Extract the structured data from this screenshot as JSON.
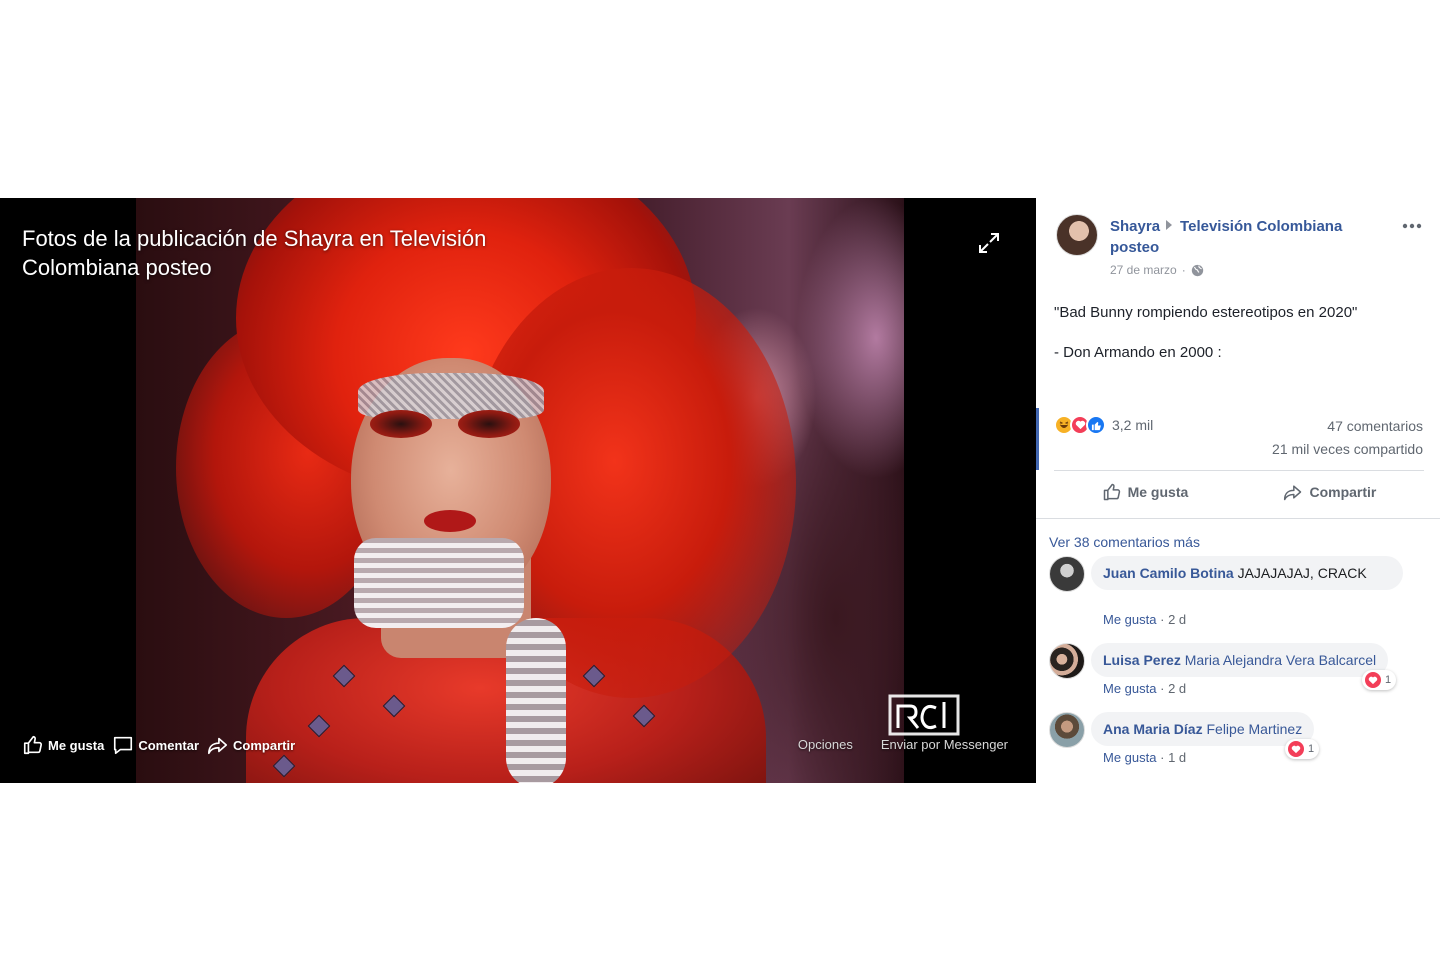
{
  "viewer": {
    "title": "Fotos de la publicación de Shayra en Televisión Colombiana posteo",
    "actions": {
      "like": "Me gusta",
      "comment": "Comentar",
      "share": "Compartir"
    },
    "options": "Opciones",
    "send_messenger": "Enviar por Messenger",
    "icons": [
      "expand-icon",
      "rcn-logo"
    ]
  },
  "post": {
    "author": "Shayra",
    "group": "Televisión Colombiana",
    "group_suffix": "posteo",
    "date": "27 de marzo",
    "dot": "·",
    "text_line1": "\"Bad Bunny rompiendo estereotipos en 2020\"",
    "text_line2": "- Don Armando en 2000 :",
    "reactions_count": "3,2 mil",
    "comments_count": "47 comentarios",
    "shares_count": "21 mil veces compartido",
    "like_label": "Me gusta",
    "share_label": "Compartir"
  },
  "comments": {
    "view_more": "Ver 38 comentarios más",
    "items": [
      {
        "author": "Juan Camilo Botina",
        "text": "JAJAJAJAJ, CRACK",
        "tag": "",
        "like": "Me gusta",
        "time": "2 d",
        "reaction_count": ""
      },
      {
        "author": "Luisa Perez",
        "text": "",
        "tag": "Maria Alejandra Vera Balcarcel",
        "like": "Me gusta",
        "time": "2 d",
        "reaction_count": "1"
      },
      {
        "author": "Ana Maria Díaz",
        "text": "",
        "tag": "Felipe Martinez",
        "like": "Me gusta",
        "time": "1 d",
        "reaction_count": "1"
      }
    ]
  },
  "colors": {
    "link": "#385898",
    "heart": "#f33e58",
    "like_blue": "#1877f2",
    "divider": "#dadde1"
  }
}
